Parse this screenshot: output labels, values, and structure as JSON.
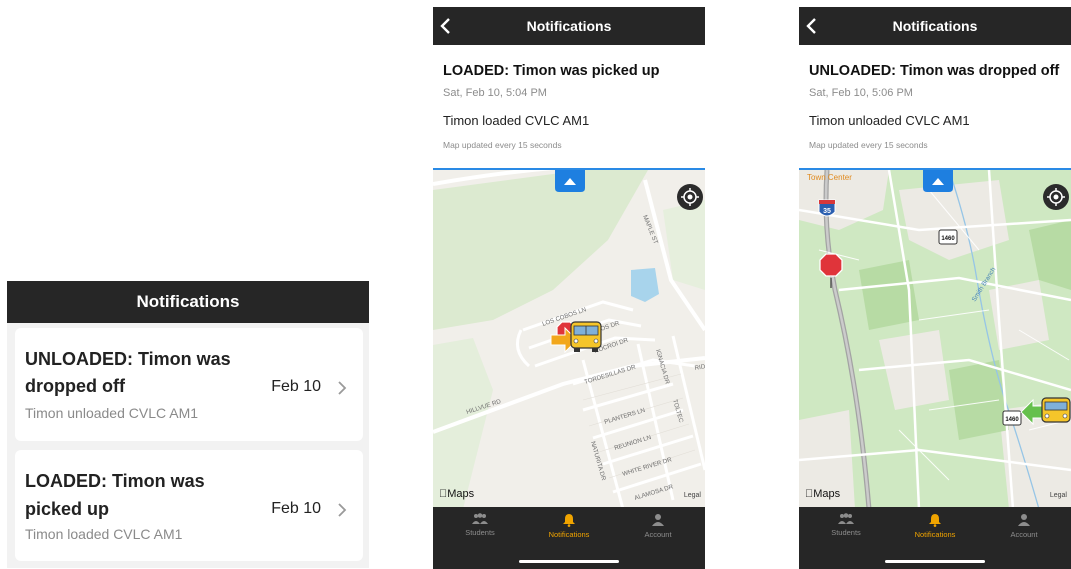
{
  "list_screen": {
    "title": "Notifications",
    "items": [
      {
        "title_line1": "UNLOADED: Timon was",
        "title_line2": "dropped off",
        "subtitle": "Timon unloaded CVLC AM1",
        "date": "Feb 10"
      },
      {
        "title_line1": "LOADED: Timon was",
        "title_line2": "picked up",
        "subtitle": "Timon loaded CVLC AM1",
        "date": "Feb 10"
      }
    ]
  },
  "detail_loaded": {
    "header": "Notifications",
    "title": "LOADED: Timon was picked up",
    "datetime": "Sat, Feb 10, 5:04 PM",
    "message": "Timon loaded CVLC AM1",
    "update_note": "Map updated every 15 seconds",
    "map": {
      "streets": [
        "MAPLE ST",
        "LOS COBOS LN",
        "LOS DR",
        "ROCROI DR",
        "TORDESILLAS DR",
        "IGNACIA DR",
        "HILLVUE RD",
        "PLANTERS LN",
        "REUNION LN",
        "NATURITA DR",
        "WHITE RIVER DR",
        "ALAMOSA DR",
        "TOLTEC",
        "RIDG"
      ],
      "brand": "Maps",
      "legal": "Legal"
    }
  },
  "detail_unloaded": {
    "header": "Notifications",
    "title": "UNLOADED: Timon was dropped off",
    "datetime": "Sat, Feb 10, 5:06 PM",
    "message": "Timon unloaded CVLC AM1",
    "update_note": "Map updated every 15 seconds",
    "map": {
      "place": "Town Center",
      "highway": "35",
      "route_shield": "1460",
      "stream": "Smith Branch",
      "brand": "Maps",
      "legal": "Legal"
    }
  },
  "tabbar": {
    "students": "Students",
    "notifications": "Notifications",
    "account": "Account"
  },
  "colors": {
    "header": "#262626",
    "accent": "#2a8ae5",
    "active_tab": "#f0a400",
    "map_green": "#cfe8c2"
  },
  "icons": [
    "back-icon",
    "chevron-right-icon",
    "location-target-icon",
    "collapse-up-icon",
    "students-icon",
    "bell-icon",
    "account-icon",
    "school-bus-icon",
    "stop-sign-icon",
    "arrow-icon"
  ]
}
